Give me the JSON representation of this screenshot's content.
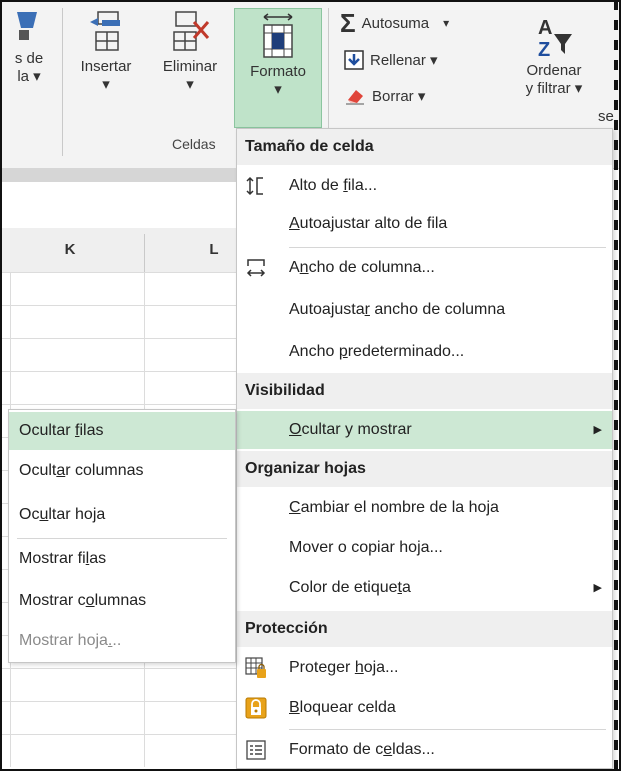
{
  "ribbon": {
    "buttons": {
      "format_styles": {
        "label_line1": "s de",
        "label_line2": "la ▾"
      },
      "insert": {
        "label": "Insertar",
        "caret": "▾"
      },
      "delete": {
        "label": "Eliminar",
        "caret": "▾"
      },
      "format": {
        "label": "Formato",
        "caret": "▾"
      }
    },
    "group_label": "Celdas",
    "editing": {
      "autosum": "Autosuma",
      "autosum_caret": "▾",
      "fill": "Rellenar ▾",
      "clear": "Borrar ▾",
      "sort_line1": "Ordenar",
      "sort_line2": "y filtrar ▾",
      "next_truncated": "se"
    }
  },
  "grid": {
    "columns": [
      "K",
      "L"
    ]
  },
  "menu": {
    "sections": {
      "cell_size": "Tamaño de celda",
      "visibility": "Visibilidad",
      "organize": "Organizar hojas",
      "protection": "Protección"
    },
    "items": {
      "row_height": {
        "pre": "Alto de ",
        "u": "f",
        "post": "ila..."
      },
      "autofit_row": {
        "pre": "",
        "u": "A",
        "post": "utoajustar alto de fila"
      },
      "col_width": {
        "pre": "A",
        "u": "n",
        "post": "cho de columna..."
      },
      "autofit_col": {
        "pre": "Autoajusta",
        "u": "r",
        "post": " ancho de columna"
      },
      "default_width": {
        "pre": "Ancho ",
        "u": "p",
        "post": "redeterminado..."
      },
      "hide_show": {
        "pre": "",
        "u": "O",
        "post": "cultar y mostrar"
      },
      "rename": {
        "pre": "",
        "u": "C",
        "post": "ambiar el nombre de la hoja"
      },
      "move_copy": {
        "pre": "Mover o copiar hoja...",
        "u": "",
        "post": ""
      },
      "tab_color": {
        "pre": "Color de etique",
        "u": "t",
        "post": "a"
      },
      "protect": {
        "pre": "Proteger ",
        "u": "h",
        "post": "oja..."
      },
      "lock": {
        "pre": "",
        "u": "B",
        "post": "loquear celda"
      },
      "format_cells": {
        "pre": "Formato de c",
        "u": "e",
        "post": "ldas..."
      }
    }
  },
  "submenu": {
    "hide_rows": {
      "pre": "Ocultar ",
      "u": "f",
      "post": "ilas"
    },
    "hide_cols": {
      "pre": "Ocult",
      "u": "a",
      "post": "r columnas"
    },
    "hide_sheet": {
      "pre": "Oc",
      "u": "u",
      "post": "ltar hoja"
    },
    "show_rows": {
      "pre": "Mostrar fi",
      "u": "l",
      "post": "as"
    },
    "show_cols": {
      "pre": "Mostrar c",
      "u": "o",
      "post": "lumnas"
    },
    "show_sheet": {
      "pre": "Mostrar hoja",
      "u": ".",
      "post": ".."
    }
  },
  "colors": {
    "highlight": "#cde8d4",
    "format_button": "#bfe3c9",
    "section_bg": "#efefef",
    "lock_icon": "#e8a21a"
  }
}
